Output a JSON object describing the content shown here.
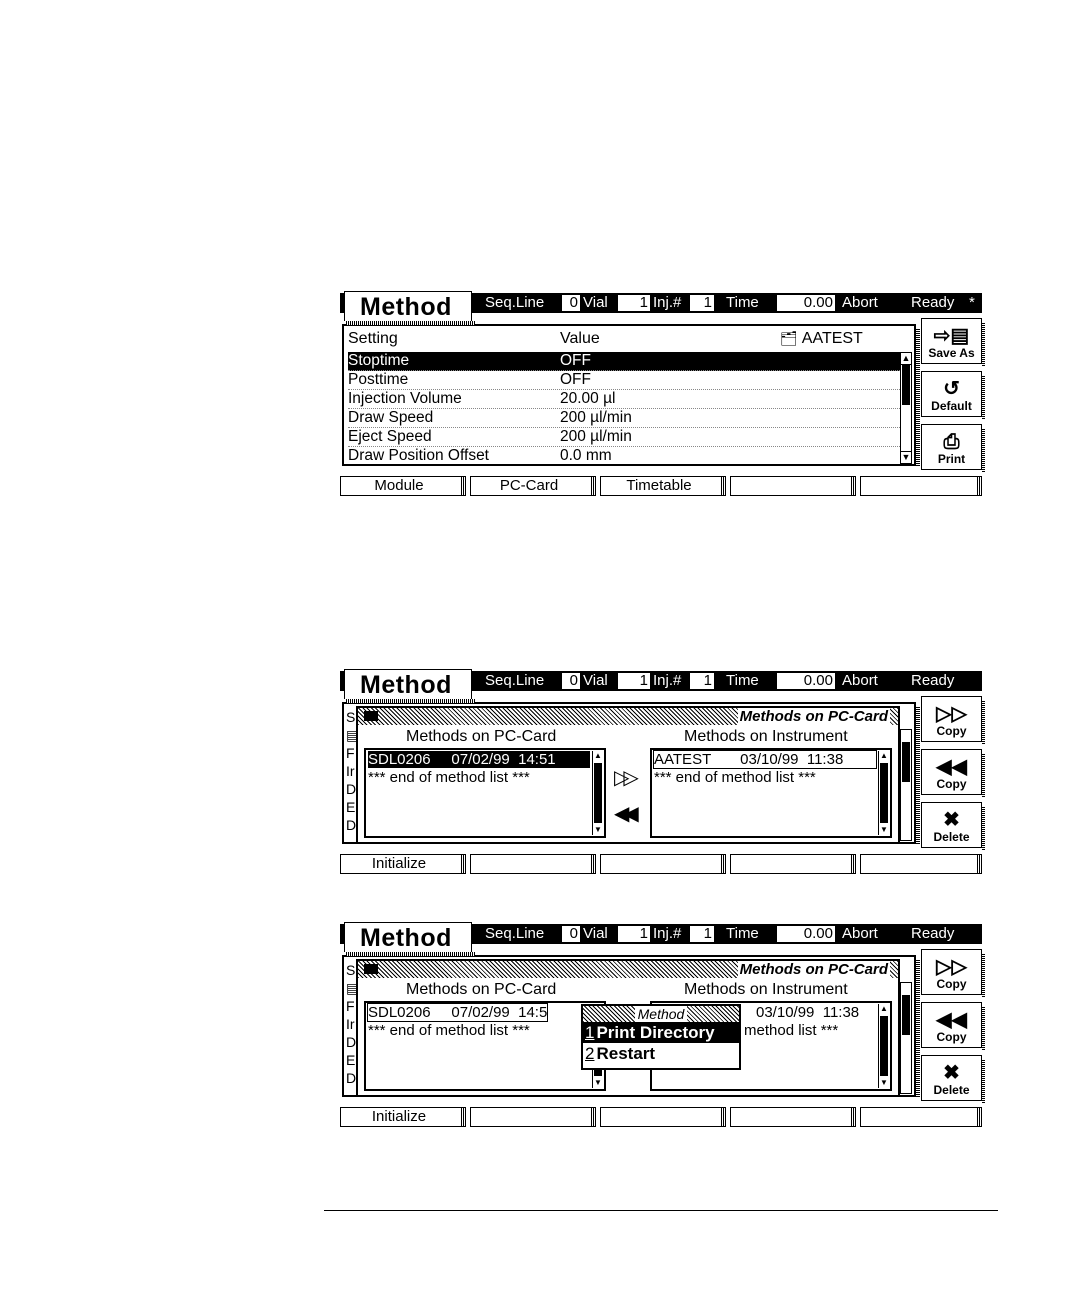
{
  "header": {
    "title": "Method",
    "seq_label": "Seq.Line",
    "seq_value": "0",
    "vial_label": "Vial",
    "vial_value": "1",
    "inj_label": "Inj.#",
    "inj_value": "1",
    "time_label": "Time",
    "time_value": "0.00",
    "abort_label": "Abort",
    "status": "Ready",
    "status_mark": "*"
  },
  "screen1": {
    "col_setting": "Setting",
    "col_value": "Value",
    "method_name": "AATEST",
    "rows": [
      {
        "setting": "Stoptime",
        "value": "OFF"
      },
      {
        "setting": "Posttime",
        "value": "OFF"
      },
      {
        "setting": "Injection Volume",
        "value": "20.00 µl"
      },
      {
        "setting": "Draw Speed",
        "value": "200 µl/min"
      },
      {
        "setting": "Eject Speed",
        "value": "200 µl/min"
      },
      {
        "setting": "Draw Position Offset",
        "value": "0.0 mm"
      }
    ],
    "side_buttons": [
      "Save As",
      "Default",
      "Print"
    ],
    "softkeys": [
      "Module",
      "PC-Card",
      "Timetable",
      "",
      ""
    ]
  },
  "dialog": {
    "title": "Methods on PC-Card",
    "left_heading": "Methods on PC-Card",
    "right_heading": "Methods on Instrument",
    "left_item": "SDL0206     07/02/99  14:51",
    "left_item_clipped": "SDL0206     07/02/99  14:5",
    "right_item": "AATEST       03/10/99  11:38",
    "right_item_clipped": "03/10/99  11:38",
    "end_text": "*** end of method list ***",
    "end_text_right_clipped": "method list ***",
    "side_buttons": [
      "Copy",
      "Copy",
      "Delete"
    ],
    "softkeys": [
      "Initialize",
      "",
      "",
      "",
      ""
    ]
  },
  "popup": {
    "title": "Method",
    "items": [
      {
        "num": "1",
        "label": "Print Directory"
      },
      {
        "num": "2",
        "label": "Restart"
      }
    ]
  }
}
